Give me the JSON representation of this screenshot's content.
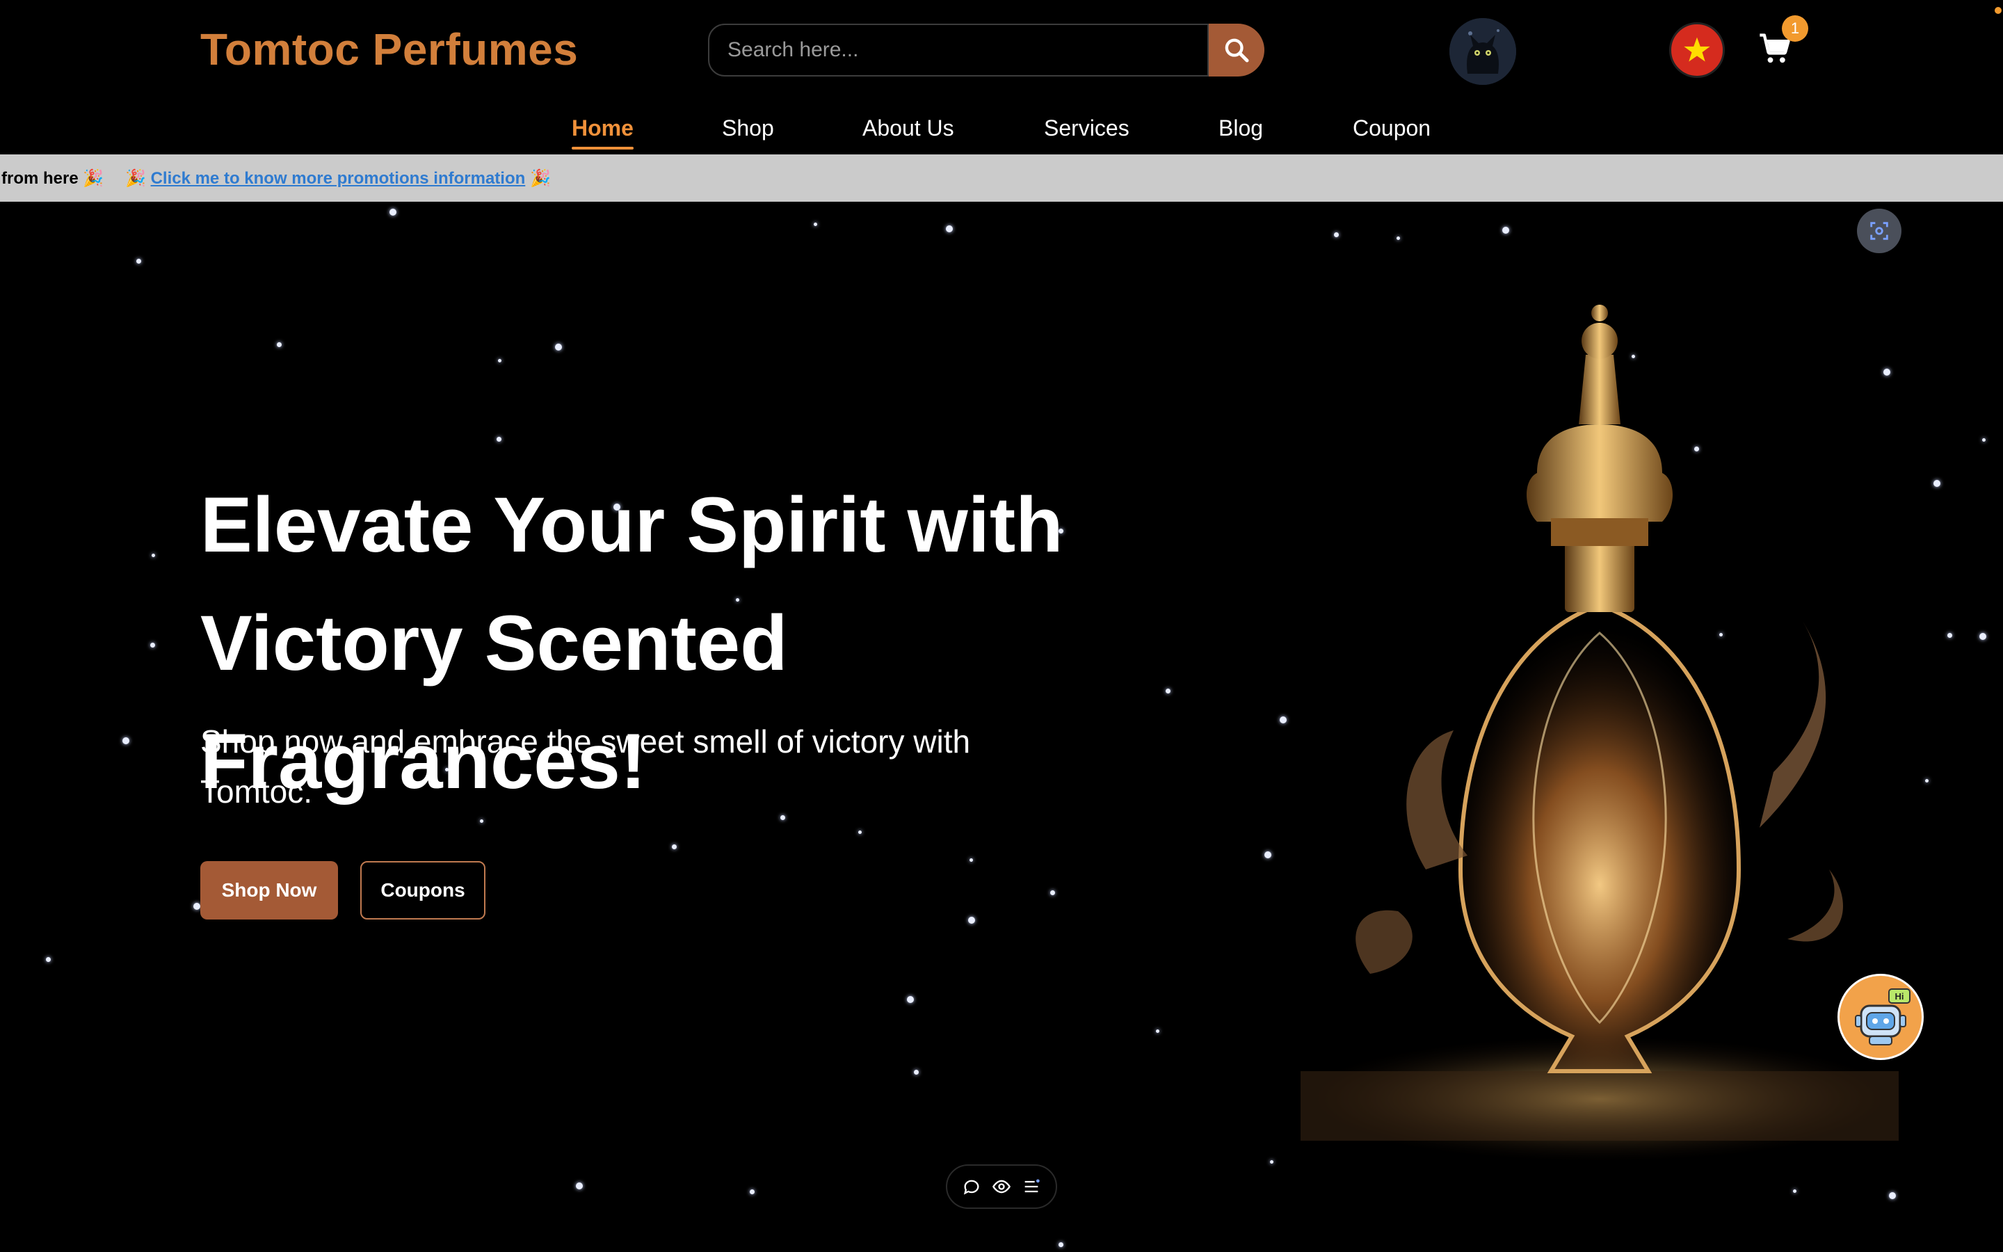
{
  "brand": {
    "name": "Tomtoc Perfumes",
    "color": "#d27f3b"
  },
  "search": {
    "placeholder": "Search here...",
    "value": ""
  },
  "cart": {
    "count": "1"
  },
  "nav": {
    "items": [
      {
        "label": "Home",
        "active": true
      },
      {
        "label": "Shop"
      },
      {
        "label": "About Us"
      },
      {
        "label": "Services"
      },
      {
        "label": "Blog"
      },
      {
        "label": "Coupon"
      }
    ]
  },
  "promo": {
    "fragment": "from here",
    "emoji": "🎉",
    "link_text": "Click me to know more promotions information"
  },
  "hero": {
    "headline_line1": "Elevate Your Spirit with",
    "headline_line2": "Victory Scented Fragrances!",
    "subtext": "Shop now and embrace the sweet smell of victory with Tomtoc.",
    "shop_button": "Shop Now",
    "coupon_button": "Coupons"
  },
  "chatbot": {
    "badge": "Hi"
  },
  "icons": {
    "search": "search-icon",
    "cart": "cart-icon",
    "flag": "vietnam-flag-icon",
    "avatar": "cat-avatar",
    "chatbot": "robot-icon",
    "scan": "scan-icon",
    "toolbar": [
      "comment-icon",
      "eye-icon",
      "menu-icon"
    ]
  },
  "colors": {
    "accent": "#a45a36",
    "nav_active": "#f0913a",
    "promo_bg": "#cbcbcb",
    "link": "#2f7bd0"
  }
}
